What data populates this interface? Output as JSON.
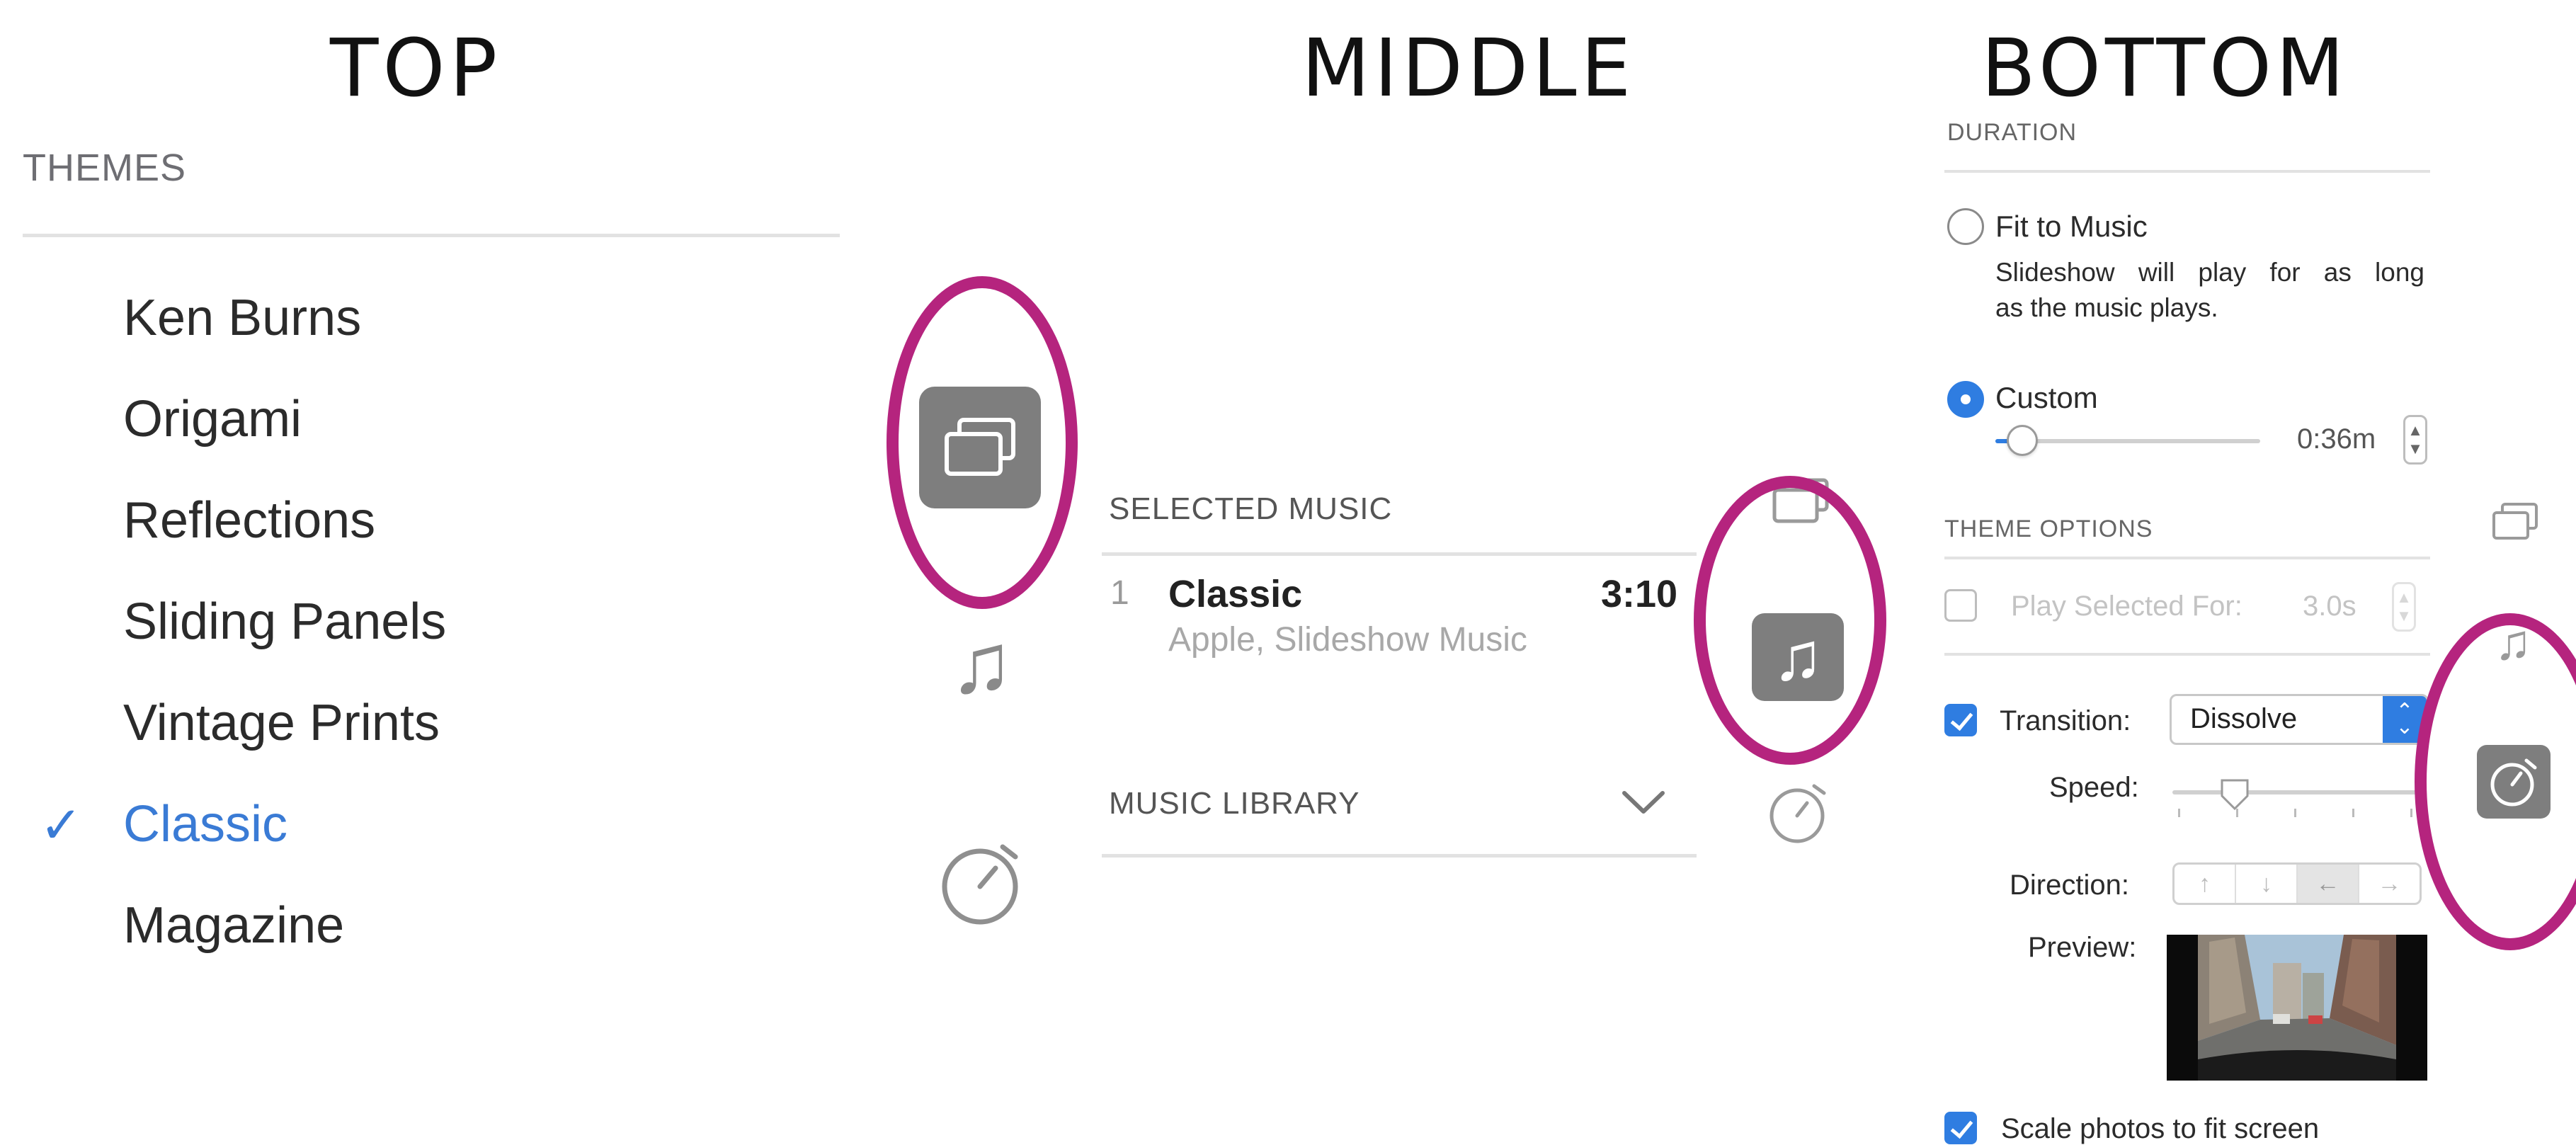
{
  "headings": {
    "top": "TOP",
    "middle": "MIDDLE",
    "bottom": "BOTTOM"
  },
  "themes": {
    "section_label": "THEMES",
    "items": [
      {
        "label": "Ken Burns",
        "selected": false
      },
      {
        "label": "Origami",
        "selected": false
      },
      {
        "label": "Reflections",
        "selected": false
      },
      {
        "label": "Sliding Panels",
        "selected": false
      },
      {
        "label": "Vintage Prints",
        "selected": false
      },
      {
        "label": "Classic",
        "selected": true
      },
      {
        "label": "Magazine",
        "selected": false
      }
    ],
    "check_glyph": "✓",
    "selected_color": "#3a7bd5"
  },
  "music": {
    "selected_label": "SELECTED MUSIC",
    "track": {
      "number": "1",
      "title": "Classic",
      "subtitle": "Apple, Slideshow Music",
      "duration": "3:10"
    },
    "library_label": "MUSIC LIBRARY"
  },
  "duration": {
    "section_label": "DURATION",
    "fit_to_music": {
      "label": "Fit to Music",
      "description_line1": "Slideshow will play for as long",
      "description_line2": "as the music plays.",
      "selected": false
    },
    "custom": {
      "label": "Custom",
      "selected": true,
      "value": "0:36m",
      "slider_fraction": 0.08
    }
  },
  "theme_options": {
    "section_label": "THEME OPTIONS",
    "play_selected": {
      "label": "Play Selected For:",
      "value": "3.0s",
      "checked": false,
      "enabled": false
    },
    "transition": {
      "label": "Transition:",
      "value": "Dissolve",
      "checked": true
    },
    "speed": {
      "label": "Speed:",
      "slider_fraction": 0.25
    },
    "direction": {
      "label": "Direction:",
      "options": [
        "↑",
        "↓",
        "←",
        "→"
      ],
      "selected_index": 2
    },
    "preview": {
      "label": "Preview:"
    },
    "scale_photos": {
      "label": "Scale photos to fit screen",
      "checked": true
    }
  },
  "icons": {
    "themes": "slides-stack-icon",
    "music": "music-note-icon",
    "duration": "stopwatch-icon",
    "note_glyph": "♫"
  },
  "colors": {
    "highlight_ring": "#b5247e",
    "accent": "#2f7de1",
    "active_tab": "#7e7e7e"
  }
}
